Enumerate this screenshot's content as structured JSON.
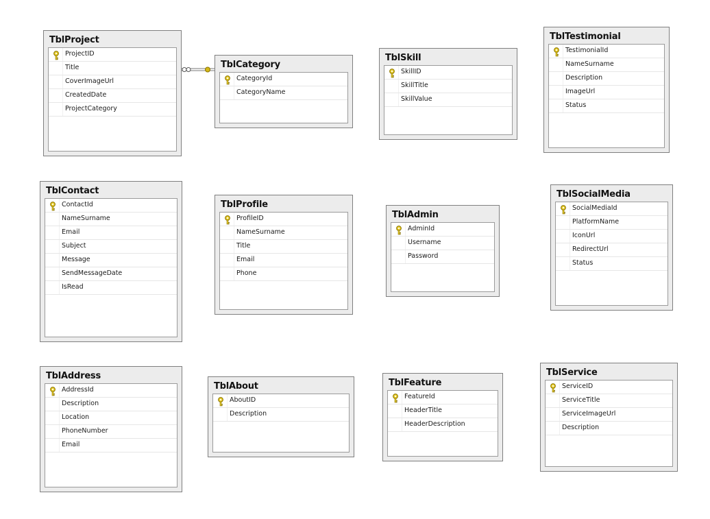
{
  "tables": {
    "project": {
      "name": "TblProject",
      "columns": [
        "ProjectID",
        "Title",
        "CoverImageUrl",
        "CreatedDate",
        "ProjectCategory"
      ],
      "pk": 0
    },
    "category": {
      "name": "TblCategory",
      "columns": [
        "CategoryId",
        "CategoryName"
      ],
      "pk": 0
    },
    "skill": {
      "name": "TblSkill",
      "columns": [
        "SkillID",
        "SkillTitle",
        "SkillValue"
      ],
      "pk": 0
    },
    "testimonial": {
      "name": "TblTestimonial",
      "columns": [
        "TestimonialId",
        "NameSurname",
        "Description",
        "ImageUrl",
        "Status"
      ],
      "pk": 0
    },
    "contact": {
      "name": "TblContact",
      "columns": [
        "ContactId",
        "NameSurname",
        "Email",
        "Subject",
        "Message",
        "SendMessageDate",
        "IsRead"
      ],
      "pk": 0
    },
    "profile": {
      "name": "TblProfile",
      "columns": [
        "ProfileID",
        "NameSurname",
        "Title",
        "Email",
        "Phone"
      ],
      "pk": 0
    },
    "admin": {
      "name": "TblAdmin",
      "columns": [
        "AdminId",
        "Username",
        "Password"
      ],
      "pk": 0
    },
    "socialmedia": {
      "name": "TblSocialMedia",
      "columns": [
        "SocialMediaId",
        "PlatformName",
        "IconUrl",
        "RedirectUrl",
        "Status"
      ],
      "pk": 0
    },
    "address": {
      "name": "TblAddress",
      "columns": [
        "AddressId",
        "Description",
        "Location",
        "PhoneNumber",
        "Email"
      ],
      "pk": 0
    },
    "about": {
      "name": "TblAbout",
      "columns": [
        "AboutID",
        "Description"
      ],
      "pk": 0
    },
    "feature": {
      "name": "TblFeature",
      "columns": [
        "FeatureId",
        "HeaderTitle",
        "HeaderDescription"
      ],
      "pk": 0
    },
    "service": {
      "name": "TblService",
      "columns": [
        "ServiceID",
        "ServiceTitle",
        "ServiceImageUrl",
        "Description"
      ],
      "pk": 0
    }
  },
  "relationships": [
    {
      "from": "category",
      "to": "project"
    }
  ],
  "colors": {
    "key": "#d4b81a",
    "border": "#7f7f7f",
    "header_bg": "#ececec"
  }
}
